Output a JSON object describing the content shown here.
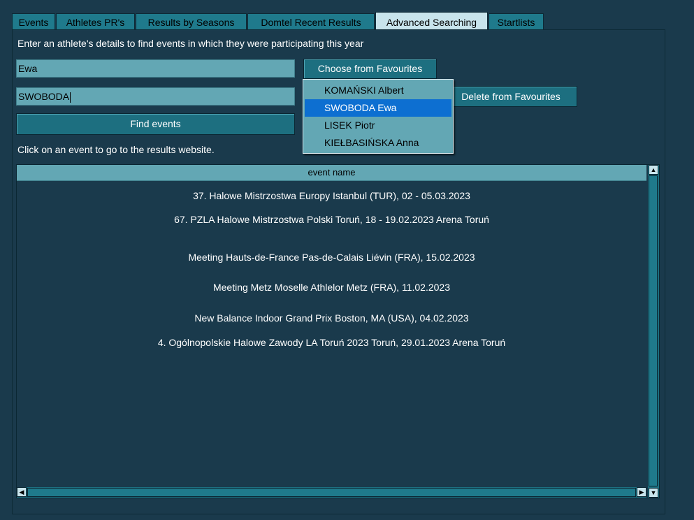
{
  "tabs": [
    {
      "label": "Events"
    },
    {
      "label": "Athletes PR's"
    },
    {
      "label": "Results by Seasons"
    },
    {
      "label": "Domtel Recent Results"
    },
    {
      "label": "Advanced Searching"
    },
    {
      "label": "Startlists"
    }
  ],
  "active_tab": "Advanced Searching",
  "form": {
    "instruction": "Enter an athlete's details to find events in which they were participating this year",
    "first_name_value": "Ewa",
    "last_name_value": "SWOBODA",
    "find_button": "Find events",
    "choose_favourites_button": "Choose from Favourites",
    "delete_favourites_button": "Delete from Favourites",
    "click_hint": "Click on an event to go to the results website."
  },
  "favourites_dropdown": {
    "options": [
      "KOMAŃSKI Albert",
      "SWOBODA Ewa",
      "LISEK Piotr",
      "KIEŁBASIŃSKA Anna"
    ],
    "selected": "SWOBODA Ewa"
  },
  "events_list": {
    "column_header": "event name",
    "rows": [
      "37. Halowe Mistrzostwa Europy  Istanbul (TUR), 02 - 05.03.2023",
      "67. PZLA Halowe Mistrzostwa Polski  Toruń, 18 - 19.02.2023 Arena Toruń",
      "Meeting Hauts-de-France Pas-de-Calais Liévin (FRA), 15.02.2023",
      "Meeting Metz Moselle Athlelor Metz (FRA), 11.02.2023",
      "New Balance Indoor Grand Prix Boston, MA (USA), 04.02.2023",
      "4. Ogólnopolskie Halowe Zawody LA Toruń 2023  Toruń, 29.01.2023 Arena Toruń"
    ]
  },
  "colors": {
    "background": "#1a3a4c",
    "tab": "#1f7a8c",
    "active_tab": "#c8e4ec",
    "field": "#63a7b4",
    "selection": "#0d6fd1"
  }
}
